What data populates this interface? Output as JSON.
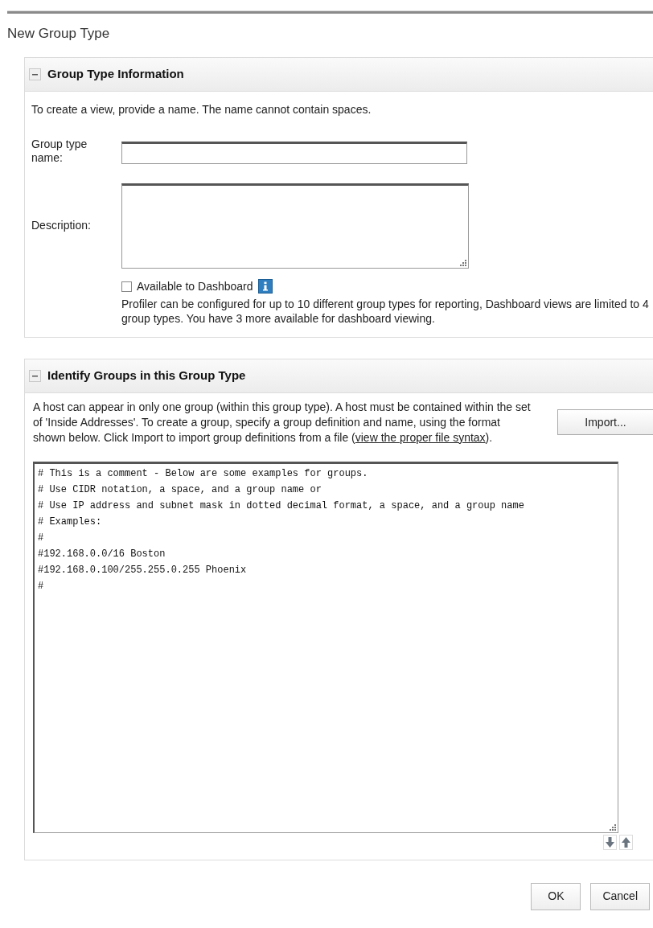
{
  "page_title": "New Group Type",
  "info_panel": {
    "title": "Group Type Information",
    "expanded": true,
    "intro": "To create a view, provide a name. The name cannot contain spaces.",
    "name_field": {
      "label": "Group type name:"
    },
    "description_field": {
      "label": "Description:"
    },
    "dashboard_checkbox": {
      "label": "Available to Dashboard",
      "checked": false
    },
    "note": "Profiler can be configured for up to 10 different group types for reporting, Dashboard views are limited to 4 group types. You have 3 more available for dashboard viewing."
  },
  "groups_panel": {
    "title": "Identify Groups in this Group Type",
    "expanded": true,
    "intro": "A host can appear in only one group (within this group type). A host must be contained within the set of 'Inside Addresses'. To create a group, specify a group definition and name, using the format shown below. Click Import to import group definitions from a file (",
    "link": "view the proper file syntax",
    "intro_end": ").",
    "import_button": "Import...",
    "definitions": [
      "# This is a comment -  Below are some examples for groups.",
      "# Use CIDR notation, a space, and a group name or",
      "# Use IP address and subnet mask in dotted decimal format, a space, and a group name",
      "# Examples:",
      "#",
      "#192.168.0.0/16 Boston",
      "#192.168.0.100/255.255.0.255 Phoenix",
      "#"
    ]
  },
  "buttons": [
    "OK",
    "Cancel"
  ]
}
